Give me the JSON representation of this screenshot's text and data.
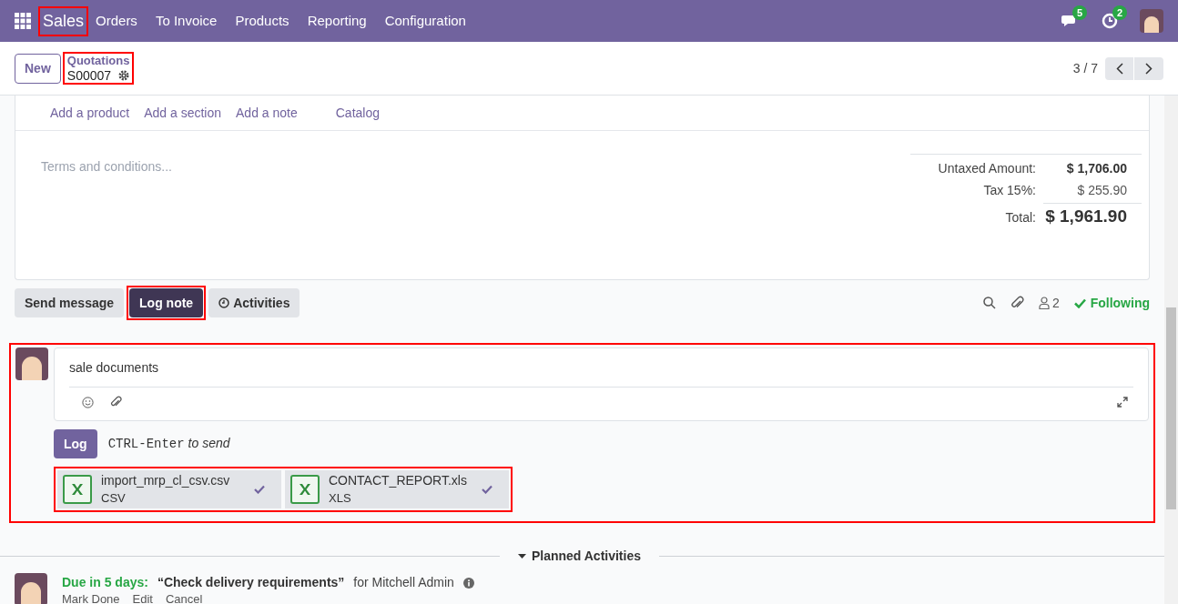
{
  "navbar": {
    "app_name": "Sales",
    "menu": [
      "Orders",
      "To Invoice",
      "Products",
      "Reporting",
      "Configuration"
    ],
    "messages_count": "5",
    "activities_count": "2"
  },
  "control_panel": {
    "new_button": "New",
    "breadcrumb": "Quotations",
    "record": "S00007",
    "pager": "3 / 7"
  },
  "line_actions": [
    "Add a product",
    "Add a section",
    "Add a note",
    "Catalog"
  ],
  "terms_placeholder": "Terms and conditions...",
  "totals": [
    {
      "label": "Untaxed Amount:",
      "value": "$ 1,706.00",
      "kind": "subtotal"
    },
    {
      "label": "Tax 15%:",
      "value": "$ 255.90",
      "kind": "tax"
    },
    {
      "label": "Total:",
      "value": "$ 1,961.90",
      "kind": "total"
    }
  ],
  "chatter": {
    "buttons": [
      {
        "label": "Send message",
        "kind": "message",
        "selected": false
      },
      {
        "label": "Log note",
        "kind": "note",
        "selected": true
      },
      {
        "label": "Activities",
        "kind": "activities",
        "selected": false
      }
    ],
    "followers_count": "2",
    "follow_label": "Following"
  },
  "composer": {
    "value": "sale documents",
    "log_button": "Log",
    "shortcut": "CTRL-Enter",
    "shortcut_hint": "to send",
    "attachments": [
      {
        "name": "import_mrp_cl_csv.csv",
        "type": "CSV",
        "uploaded": true
      },
      {
        "name": "CONTACT_REPORT.xls",
        "type": "XLS",
        "uploaded": true
      }
    ]
  },
  "planned_activities": {
    "title": "Planned Activities",
    "items": [
      {
        "due": "Due in 5 days:",
        "summary": "“Check delivery requirements”",
        "assignee": "for Mitchell Admin",
        "actions": [
          "Mark Done",
          "Edit",
          "Cancel"
        ]
      }
    ]
  }
}
